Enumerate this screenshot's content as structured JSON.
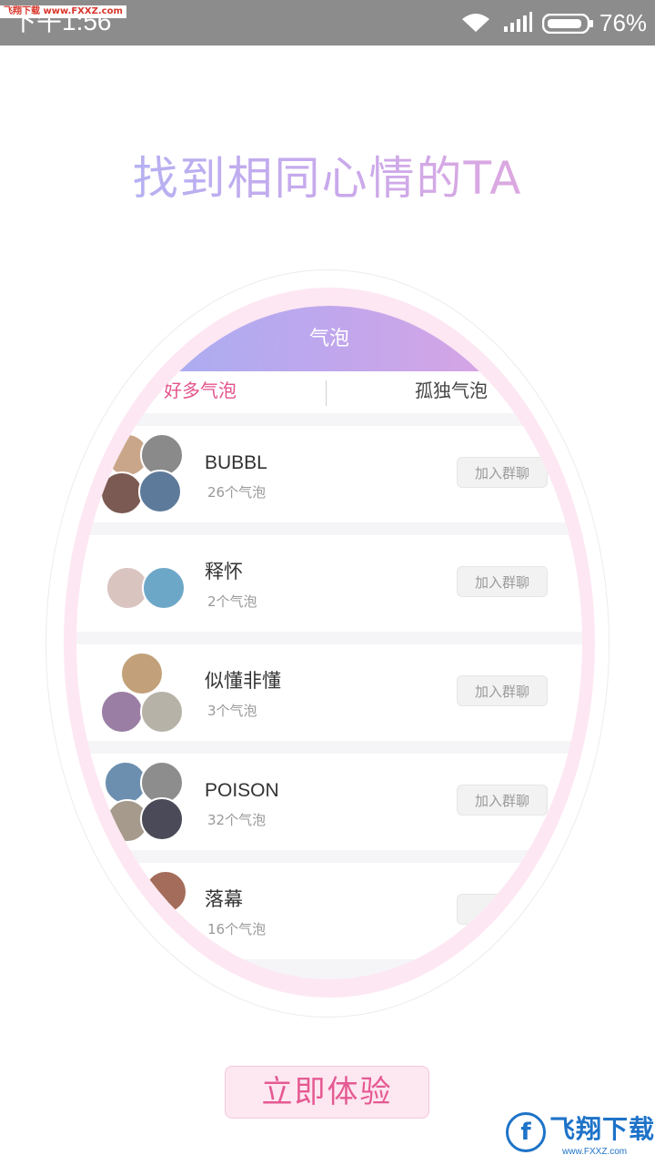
{
  "status_bar": {
    "time": "下午1:56",
    "battery": "76%",
    "watermark": "飞翔下载 www.FXXZ.com"
  },
  "headline": "找到相同心情的TA",
  "panel": {
    "header": "气泡",
    "tabs": [
      {
        "label": "好多气泡",
        "active": true
      },
      {
        "label": "孤独气泡",
        "active": false
      }
    ],
    "groups": [
      {
        "name": "BUBBL",
        "count": "26个气泡",
        "action": "加入群聊"
      },
      {
        "name": "释怀",
        "count": "2个气泡",
        "action": "加入群聊"
      },
      {
        "name": "似懂非懂",
        "count": "3个气泡",
        "action": "加入群聊"
      },
      {
        "name": "POISON",
        "count": "32个气泡",
        "action": "加入群聊"
      },
      {
        "name": "落幕",
        "count": "16个气泡",
        "action": "+"
      }
    ]
  },
  "cta": "立即体验",
  "watermark_bottom": {
    "brand": "飞翔下载",
    "url": "www.FXXZ.com"
  },
  "colors": {
    "accent_pink": "#e4548c",
    "gradient_start": "#9fb0f5",
    "gradient_end": "#e3a4df"
  }
}
